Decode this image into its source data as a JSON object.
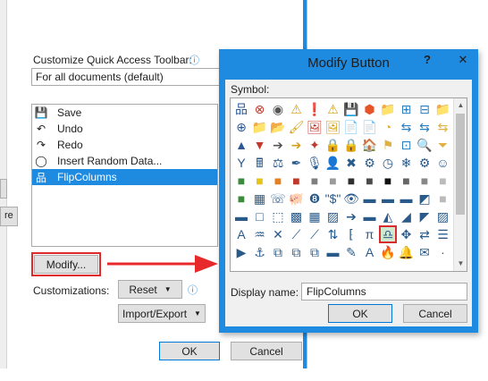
{
  "bg": {
    "toolbar_label": "Customize Quick Access Toolbar:",
    "toolbar_combo": "For all documents (default)",
    "list": [
      {
        "icon": "save-icon",
        "glyph": "💾",
        "label": "Save"
      },
      {
        "icon": "undo-icon",
        "glyph": "↶",
        "label": "Undo"
      },
      {
        "icon": "redo-icon",
        "glyph": "↷",
        "label": "Redo"
      },
      {
        "icon": "circle-icon",
        "glyph": "◯",
        "label": "Insert Random Data..."
      },
      {
        "icon": "flow-chart-icon",
        "glyph": "品",
        "label": "FlipColumns"
      }
    ],
    "selected_index": 4,
    "modify": "Modify...",
    "customizations": "Customizations:",
    "reset": "Reset",
    "import_export": "Import/Export",
    "ok": "OK",
    "cancel": "Cancel",
    "stub_re": "re",
    "info_glyph": "ⓘ"
  },
  "modal": {
    "title": "Modify Button",
    "help": "?",
    "close": "✕",
    "symbol_label": "Symbol:",
    "display_name_label": "Display name:",
    "display_name_value": "FlipColumns",
    "ok": "OK",
    "cancel": "Cancel",
    "selected_cell": 92,
    "symbols": [
      "品",
      "⊗",
      "◉",
      "⚠",
      "❗",
      "⚠",
      "💾",
      "⬢",
      "📁",
      "⊞",
      "⊟",
      "📁",
      "⊕",
      "📁",
      "📂",
      "🖌",
      "🖼",
      "🖼",
      "📄",
      "📄",
      "◔",
      "⇆",
      "⇆",
      "⇆",
      "▲",
      "▼",
      "➔",
      "➔",
      "✦",
      "🔒",
      "🔒",
      "🏠",
      "⚑",
      "⊡",
      "🔍",
      "⏷",
      "Y",
      "🖩",
      "⚖",
      "✒",
      "🎙",
      "👤",
      "✖",
      "⚙",
      "◷",
      "❄",
      "⚙",
      "☺",
      "■",
      "■",
      "■",
      "■",
      "■",
      "■",
      "■",
      "■",
      "■",
      "■",
      "■",
      "■",
      "■",
      "▦",
      "☏",
      "🐖",
      "❽",
      "\"$\"",
      "👁",
      "▬",
      "▬",
      "▬",
      "◩",
      "■",
      "▬",
      "□",
      "⬚",
      "▩",
      "▦",
      "▨",
      "➔",
      "▬",
      "◭",
      "◢",
      "◤",
      "▨",
      "A",
      "♒",
      "✕",
      "⟋",
      "⟋",
      "⇅",
      "⁅",
      "π",
      "♎",
      "✥",
      "⇄",
      "☰",
      "▶",
      "⚓",
      "⧉",
      "⧉",
      "⧉",
      "▬",
      "✎",
      "A",
      "🔥",
      "🔔",
      "✉",
      "·"
    ]
  }
}
